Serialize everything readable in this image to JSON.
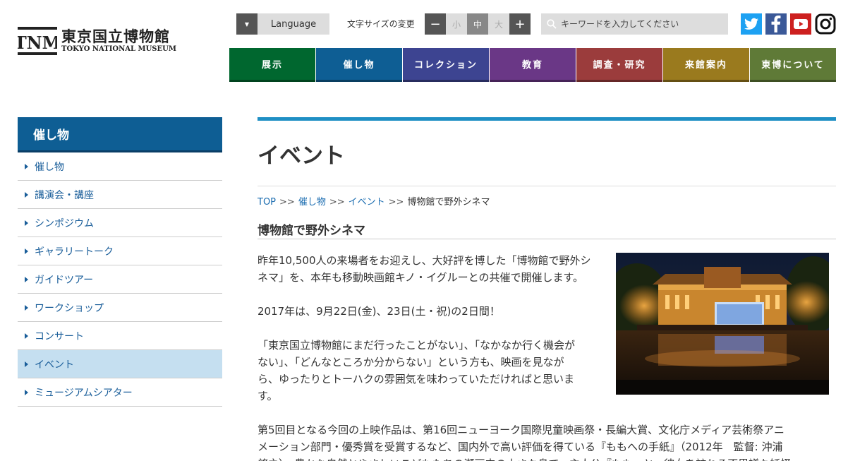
{
  "logo": {
    "mark": "TNM",
    "name_jp": "東京国立博物館",
    "name_en": "TOKYO NATIONAL MUSEUM"
  },
  "header": {
    "language_label": "Language",
    "font_size_label": "文字サイズの変更",
    "font_size": {
      "minus": "−",
      "small": "小",
      "medium": "中",
      "large": "大",
      "plus": "+"
    },
    "search_placeholder": "キーワードを入力してください"
  },
  "nav": [
    {
      "label": "展示",
      "color": "#00672f"
    },
    {
      "label": "催し物",
      "color": "#0e5e94"
    },
    {
      "label": "コレクション",
      "color": "#3d4491"
    },
    {
      "label": "教育",
      "color": "#6a3786"
    },
    {
      "label": "調査・研究",
      "color": "#9b3c3c"
    },
    {
      "label": "来館案内",
      "color": "#9a7a1e"
    },
    {
      "label": "東博について",
      "color": "#5f7a37"
    }
  ],
  "sidebar": {
    "heading": "催し物",
    "items": [
      {
        "label": "催し物"
      },
      {
        "label": "講演会・講座"
      },
      {
        "label": "シンポジウム"
      },
      {
        "label": "ギャラリートーク"
      },
      {
        "label": "ガイドツアー"
      },
      {
        "label": "ワークショップ"
      },
      {
        "label": "コンサート"
      },
      {
        "label": "イベント",
        "active": true
      },
      {
        "label": "ミュージアムシアター"
      }
    ]
  },
  "main": {
    "title": "イベント",
    "breadcrumb": {
      "top": "TOP",
      "sep": ">>",
      "events": "催し物",
      "event": "イベント",
      "current": "博物館で野外シネマ"
    },
    "subtitle": "博物館で野外シネマ",
    "paragraphs": {
      "p1a": "昨年10,500人の来場者をお迎えし、大好評を博した「博物館で野外シ",
      "p1b": "ネマ」を、本年も移動映画館キノ・イグルーとの共催で開催します。",
      "p2": "2017年は、9月22日(金)、23日(土・祝)の2日間！",
      "p3a": "「東京国立博物館にまだ行ったことがない」、「なかなか行く機会が",
      "p3b": "ない」、「どんなところか分からない」という方も、映画を見なが",
      "p3c": "ら、ゆったりとトーハクの雰囲気を味わっていただければと思いま",
      "p3d": "す。",
      "p4a": "第5回目となる今回の上映作品は、第16回ニューヨーク国際児童映画祭・長編大賞、文化庁メディア芸術祭アニ",
      "p4b": "メーション部門・優秀賞を受賞するなど、国内外で高い評価を得ている『ももへの手紙』（2012年　監督: 沖浦",
      "p4c": "啓之）。豊かな自然とやさしいこどもたちの瀬戸内の小さな島で、主人公『もも』と、彼女を訪れる不思議な妖怪"
    }
  }
}
